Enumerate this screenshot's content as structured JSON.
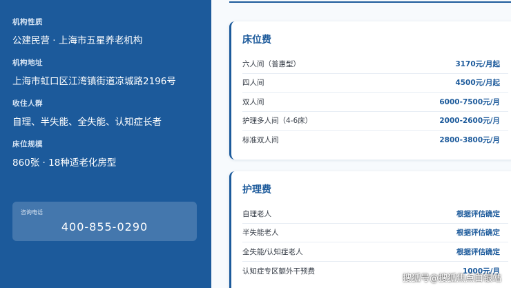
{
  "info": [
    {
      "label": "机构性质",
      "value": "公建民营 · 上海市五星养老机构"
    },
    {
      "label": "机构地址",
      "value": "上海市虹口区江湾镇街道凉城路2196号"
    },
    {
      "label": "收住人群",
      "value": "自理、半失能、全失能、认知症长者"
    },
    {
      "label": "床位规模",
      "value": "860张 · 18种适老化房型"
    }
  ],
  "phone": {
    "label": "咨询电话",
    "number": "400-855-0290"
  },
  "bed_fees": {
    "title": "床位费",
    "rows": [
      {
        "name": "六人间（普惠型）",
        "price": "3170元/月起"
      },
      {
        "name": "四人间",
        "price": "4500元/月起"
      },
      {
        "name": "双人间",
        "price": "6000-7500元/月"
      },
      {
        "name": "护理多人间（4-6床）",
        "price": "2000-2600元/月"
      },
      {
        "name": "标准双人间",
        "price": "2800-3800元/月"
      }
    ]
  },
  "care_fees": {
    "title": "护理费",
    "rows": [
      {
        "name": "自理老人",
        "price": "根据评估确定"
      },
      {
        "name": "半失能老人",
        "price": "根据评估确定"
      },
      {
        "name": "全失能/认知症老人",
        "price": "根据评估确定"
      },
      {
        "name": "认知症专区额外干预费",
        "price": "1000元/月"
      }
    ]
  },
  "watermark": "搜狐号@搜狐焦点白银站"
}
